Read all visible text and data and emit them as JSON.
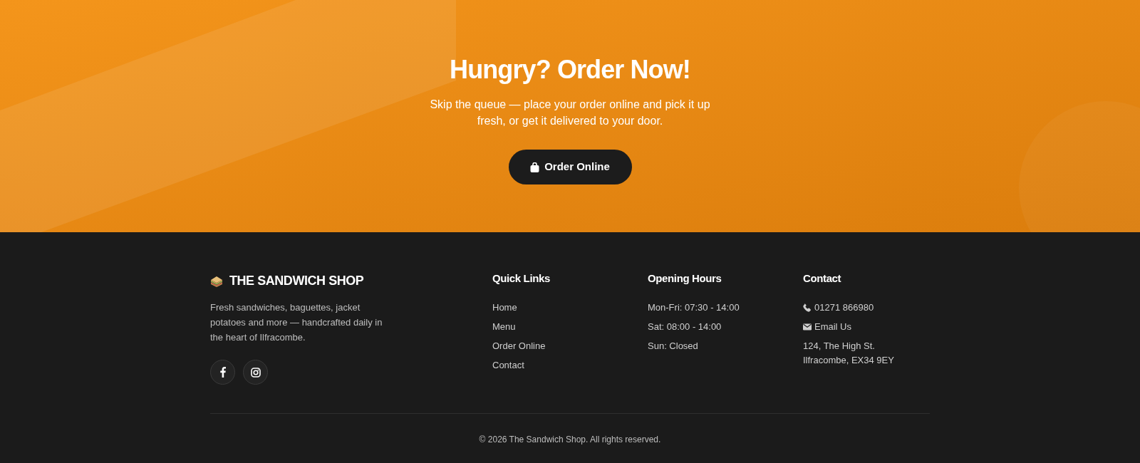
{
  "hero": {
    "title": "Hungry? Order Now!",
    "text": "Skip the queue — place your order online and pick it up fresh, or get it delivered to your door.",
    "button": "Order Online"
  },
  "footer": {
    "brand": "THE SANDWICH SHOP",
    "description": "Fresh sandwiches, baguettes, jacket potatoes and more — handcrafted daily in the heart of Ilfracombe.",
    "columns": [
      {
        "heading": "Quick Links",
        "items": [
          {
            "kind": "link",
            "text": "Home"
          },
          {
            "kind": "link",
            "text": "Menu"
          },
          {
            "kind": "link",
            "text": "Order Online"
          },
          {
            "kind": "link",
            "text": "Contact"
          }
        ]
      },
      {
        "heading": "Opening Hours",
        "items": [
          {
            "kind": "text",
            "text": "Mon-Fri: 07:30 - 14:00"
          },
          {
            "kind": "text",
            "text": "Sat: 08:00 - 14:00"
          },
          {
            "kind": "text",
            "text": "Sun: Closed"
          }
        ]
      },
      {
        "heading": "Contact",
        "items": [
          {
            "kind": "phone",
            "text": "01271 866980"
          },
          {
            "kind": "email",
            "text": "Email Us"
          },
          {
            "kind": "address",
            "text": "124, The High St.\nIlfracombe, EX34 9EY"
          }
        ]
      }
    ],
    "copyright": "© 2026 The Sandwich Shop. All rights reserved."
  }
}
